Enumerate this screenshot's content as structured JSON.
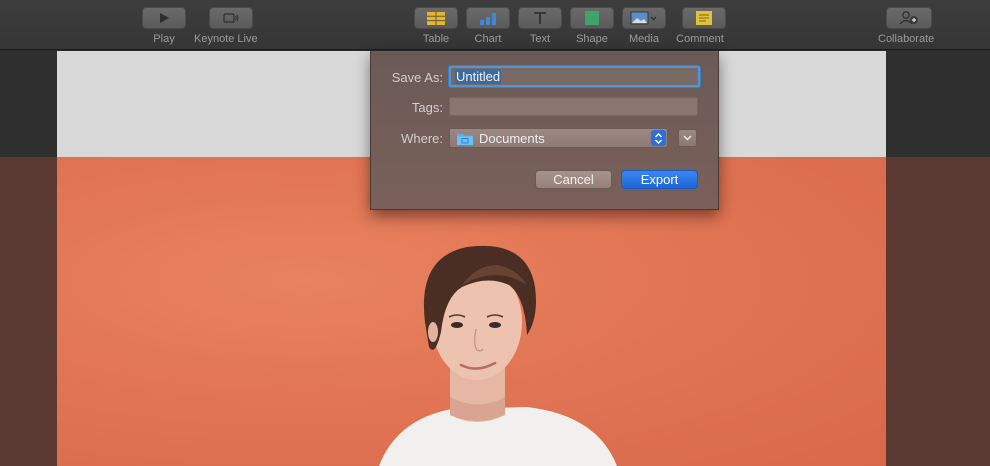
{
  "toolbar": {
    "items": [
      {
        "label": "Play",
        "icon": "play-icon"
      },
      {
        "label": "Keynote Live",
        "icon": "keynote-live-icon"
      },
      {
        "label": "Table",
        "icon": "table-icon"
      },
      {
        "label": "Chart",
        "icon": "chart-icon"
      },
      {
        "label": "Text",
        "icon": "text-icon"
      },
      {
        "label": "Shape",
        "icon": "shape-icon"
      },
      {
        "label": "Media",
        "icon": "media-icon"
      },
      {
        "label": "Comment",
        "icon": "comment-icon"
      },
      {
        "label": "Collaborate",
        "icon": "collaborate-icon"
      }
    ]
  },
  "dialog": {
    "save_as_label": "Save As:",
    "save_as_value": "Untitled",
    "tags_label": "Tags:",
    "tags_value": "",
    "where_label": "Where:",
    "where_value": "Documents",
    "cancel_label": "Cancel",
    "export_label": "Export"
  },
  "colors": {
    "accent": "#1e66d8",
    "slide_background": "#e27655"
  }
}
